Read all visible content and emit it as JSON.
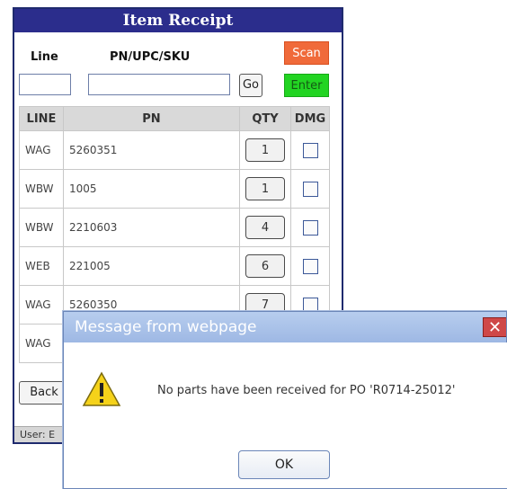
{
  "app": {
    "title": "Item Receipt"
  },
  "form": {
    "line_label": "Line",
    "pn_label": "PN/UPC/SKU",
    "line_value": "",
    "pn_value": "",
    "go_label": "Go",
    "scan_label": "Scan",
    "enter_label": "Enter"
  },
  "table": {
    "headers": [
      "LINE",
      "PN",
      "QTY",
      "DMG"
    ],
    "rows": [
      {
        "line": "WAG",
        "pn": "5260351",
        "qty": "1",
        "dmg": false
      },
      {
        "line": "WBW",
        "pn": "1005",
        "qty": "1",
        "dmg": false
      },
      {
        "line": "WBW",
        "pn": "2210603",
        "qty": "4",
        "dmg": false
      },
      {
        "line": "WEB",
        "pn": "221005",
        "qty": "6",
        "dmg": false
      },
      {
        "line": "WAG",
        "pn": "5260350",
        "qty": "7",
        "dmg": false
      },
      {
        "line": "WAG",
        "pn": "",
        "qty": "",
        "dmg": false
      }
    ]
  },
  "back_label": "Back",
  "footer": {
    "user_text": "User: E"
  },
  "dialog": {
    "title": "Message from webpage",
    "message": "No parts have been received for PO 'R0714-25012'",
    "ok_label": "OK",
    "close_glyph": "✕"
  },
  "colors": {
    "titlebar": "#2b2d8c",
    "scan": "#f06a3a",
    "enter": "#22d422",
    "dialog_title": "#9eb8e4",
    "close": "#cf4848"
  }
}
